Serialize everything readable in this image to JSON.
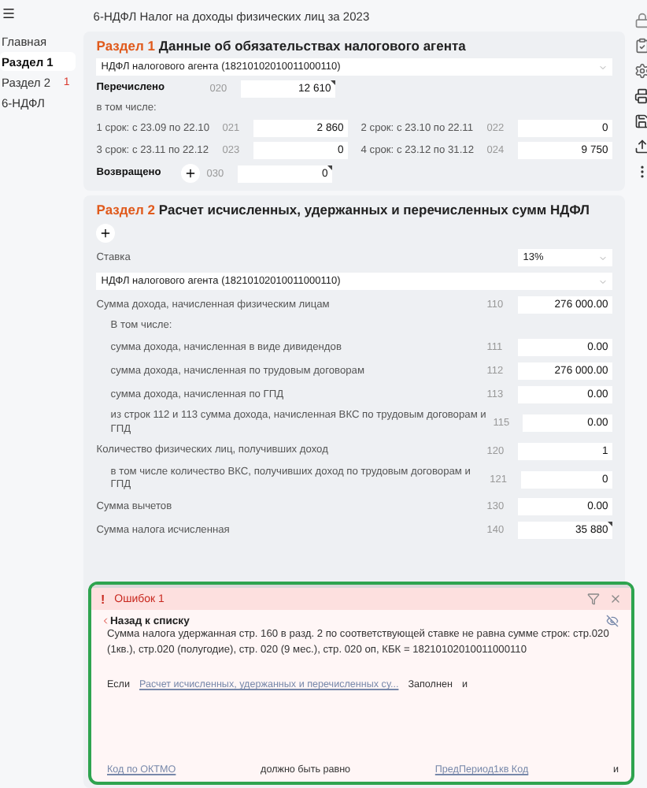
{
  "document_title": "6-НДФЛ Налог на доходы физических лиц за 2023",
  "sidebar": {
    "items": [
      {
        "label": "Главная",
        "selected": false
      },
      {
        "label": "Раздел 1",
        "selected": true
      },
      {
        "label": "Раздел 2",
        "selected": false,
        "badge": "1"
      },
      {
        "label": "6-НДФЛ",
        "selected": false
      }
    ]
  },
  "section1": {
    "number": "Раздел 1",
    "title": "Данные об обязательствах налогового агента",
    "tax_select": "НДФЛ налогового агента (18210102010011000110)",
    "paid": {
      "label": "Перечислено",
      "code": "020",
      "value": "12 610",
      "flagged": true
    },
    "including": "в том числе:",
    "terms": [
      {
        "label": "1 срок: с 23.09 по 22.10",
        "code": "021",
        "value": "2 860",
        "flagged": false
      },
      {
        "label": "2 срок: с 23.10 по 22.11",
        "code": "022",
        "value": "0",
        "flagged": false
      },
      {
        "label": "3 срок: с 23.11 по 22.12",
        "code": "023",
        "value": "0",
        "flagged": false
      },
      {
        "label": "4 срок: с 23.12 по 31.12",
        "code": "024",
        "value": "9 750",
        "flagged": false
      }
    ],
    "returned": {
      "label": "Возвращено",
      "code": "030",
      "value": "0",
      "flagged": true
    }
  },
  "section2": {
    "number": "Раздел 2",
    "title": "Расчет исчисленных, удержанных и перечисленных сумм НДФЛ",
    "rate": {
      "label": "Ставка",
      "value": "13%"
    },
    "tax_select": "НДФЛ налогового агента (18210102010011000110)",
    "rows": [
      {
        "kind": "field",
        "label": "Сумма дохода, начисленная физическим лицам",
        "code": "110",
        "value": "276 000.00",
        "indented": false,
        "flagged": false
      },
      {
        "kind": "heading",
        "label": "В том числе:",
        "indented": true
      },
      {
        "kind": "field",
        "label": "сумма дохода, начисленная в виде дивидендов",
        "code": "111",
        "value": "0.00",
        "indented": true,
        "flagged": false
      },
      {
        "kind": "field",
        "label": "сумма дохода, начисленная по трудовым договорам",
        "code": "112",
        "value": "276 000.00",
        "indented": true,
        "flagged": false
      },
      {
        "kind": "field",
        "label": "сумма дохода, начисленная по ГПД",
        "code": "113",
        "value": "0.00",
        "indented": true,
        "flagged": false
      },
      {
        "kind": "field",
        "label": "из строк 112 и 113 сумма дохода, начисленная ВКС по трудовым договорам и ГПД",
        "code": "115",
        "value": "0.00",
        "indented": true,
        "flagged": false
      },
      {
        "kind": "field",
        "label": "Количество физических лиц, получивших доход",
        "code": "120",
        "value": "1",
        "indented": false,
        "flagged": false
      },
      {
        "kind": "field",
        "label": "в том числе количество ВКС, получивших доход по трудовым договорам и ГПД",
        "code": "121",
        "value": "0",
        "indented": true,
        "flagged": false
      },
      {
        "kind": "field",
        "label": "Сумма вычетов",
        "code": "130",
        "value": "0.00",
        "indented": false,
        "flagged": false
      },
      {
        "kind": "field",
        "label": "Сумма налога исчисленная",
        "code": "140",
        "value": "35 880",
        "indented": false,
        "flagged": true
      }
    ]
  },
  "error_panel": {
    "icon": "!",
    "title": "Ошибок 1",
    "back": "Назад к списку",
    "message": "Сумма налога удержанная стр. 160 в разд. 2 по соответствующей ставке не равна сумме строк: стр.020 (1кв.), стр.020 (полугодие), стр. 020 (9 мес.), стр. 020 оп, КБК = 18210102010011000110",
    "condition": [
      {
        "kind": "text",
        "text": "Если"
      },
      {
        "kind": "link",
        "text": "Расчет исчисленных, удержанных и перечисленных су..."
      },
      {
        "kind": "text",
        "text": "Заполнен"
      },
      {
        "kind": "text",
        "text": "и"
      }
    ],
    "footer": [
      {
        "kind": "link",
        "text": "Код по ОКТМО"
      },
      {
        "kind": "text",
        "text": "должно быть равно"
      },
      {
        "kind": "link",
        "text": "ПредПериод1кв Код"
      },
      {
        "kind": "text",
        "text": "и"
      }
    ]
  }
}
